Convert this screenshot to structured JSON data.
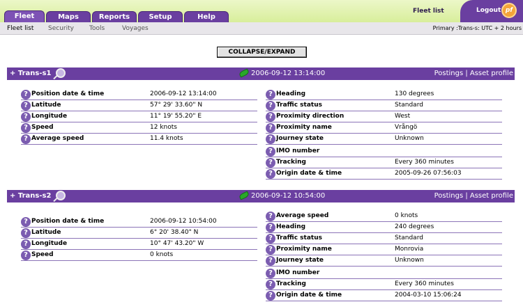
{
  "nav": {
    "tabs": [
      {
        "label": "Fleet",
        "active": true
      },
      {
        "label": "Maps",
        "active": false
      },
      {
        "label": "Reports",
        "active": false
      },
      {
        "label": "Setup",
        "active": false
      },
      {
        "label": "Help",
        "active": false
      }
    ],
    "page_title": "Fleet list",
    "logout_label": "Logout",
    "logo_text": "pf"
  },
  "subnav": {
    "items": [
      "Fleet list",
      "Security",
      "Tools",
      "Voyages"
    ],
    "timezone": "Primary :Trans-s: UTC + 2 hours"
  },
  "collapse_label": "COLLAPSE/EXPAND",
  "vessels": [
    {
      "name": "Trans-s1",
      "datetime": "2006-09-12 13:14:00",
      "links": "Postings | Asset profile",
      "left_fields": [
        {
          "label": "Position date & time",
          "value": "2006-09-12 13:14:00"
        },
        {
          "label": "Latitude",
          "value": "57° 29' 33.60\" N"
        },
        {
          "label": "Longitude",
          "value": "11° 19' 55.20\" E"
        },
        {
          "label": "Speed",
          "value": "12 knots"
        },
        {
          "label": "Average speed",
          "value": "11.4 knots"
        }
      ],
      "right_fields": [
        {
          "label": "Heading",
          "value": "130 degrees"
        },
        {
          "label": "Traffic status",
          "value": "Standard"
        },
        {
          "label": "Proximity direction",
          "value": "West"
        },
        {
          "label": "Proximity name",
          "value": "Vrångö"
        },
        {
          "label": "Journey state",
          "value": "Unknown"
        },
        {
          "label": "IMO number",
          "value": ""
        },
        {
          "label": "Tracking",
          "value": "Every 360 minutes"
        },
        {
          "label": "Origin date & time",
          "value": "2005-09-26 07:56:03"
        }
      ]
    },
    {
      "name": "Trans-s2",
      "datetime": "2006-09-12 10:54:00",
      "links": "Postings | Asset profile",
      "left_fields": [
        {
          "label": "Position date & time",
          "value": "2006-09-12 10:54:00"
        },
        {
          "label": "Latitude",
          "value": "6° 20' 38.40\" N"
        },
        {
          "label": "Longitude",
          "value": "10° 47' 43.20\" W"
        },
        {
          "label": "Speed",
          "value": "0 knots"
        }
      ],
      "right_fields": [
        {
          "label": "Average speed",
          "value": "0 knots"
        },
        {
          "label": "Heading",
          "value": "240 degrees"
        },
        {
          "label": "Traffic status",
          "value": "Standard"
        },
        {
          "label": "Proximity name",
          "value": "Monrovia"
        },
        {
          "label": "Journey state",
          "value": "Unknown"
        },
        {
          "label": "IMO number",
          "value": ""
        },
        {
          "label": "Tracking",
          "value": "Every 360 minutes"
        },
        {
          "label": "Origin date & time",
          "value": "2004-03-10 15:06:24"
        }
      ]
    }
  ]
}
